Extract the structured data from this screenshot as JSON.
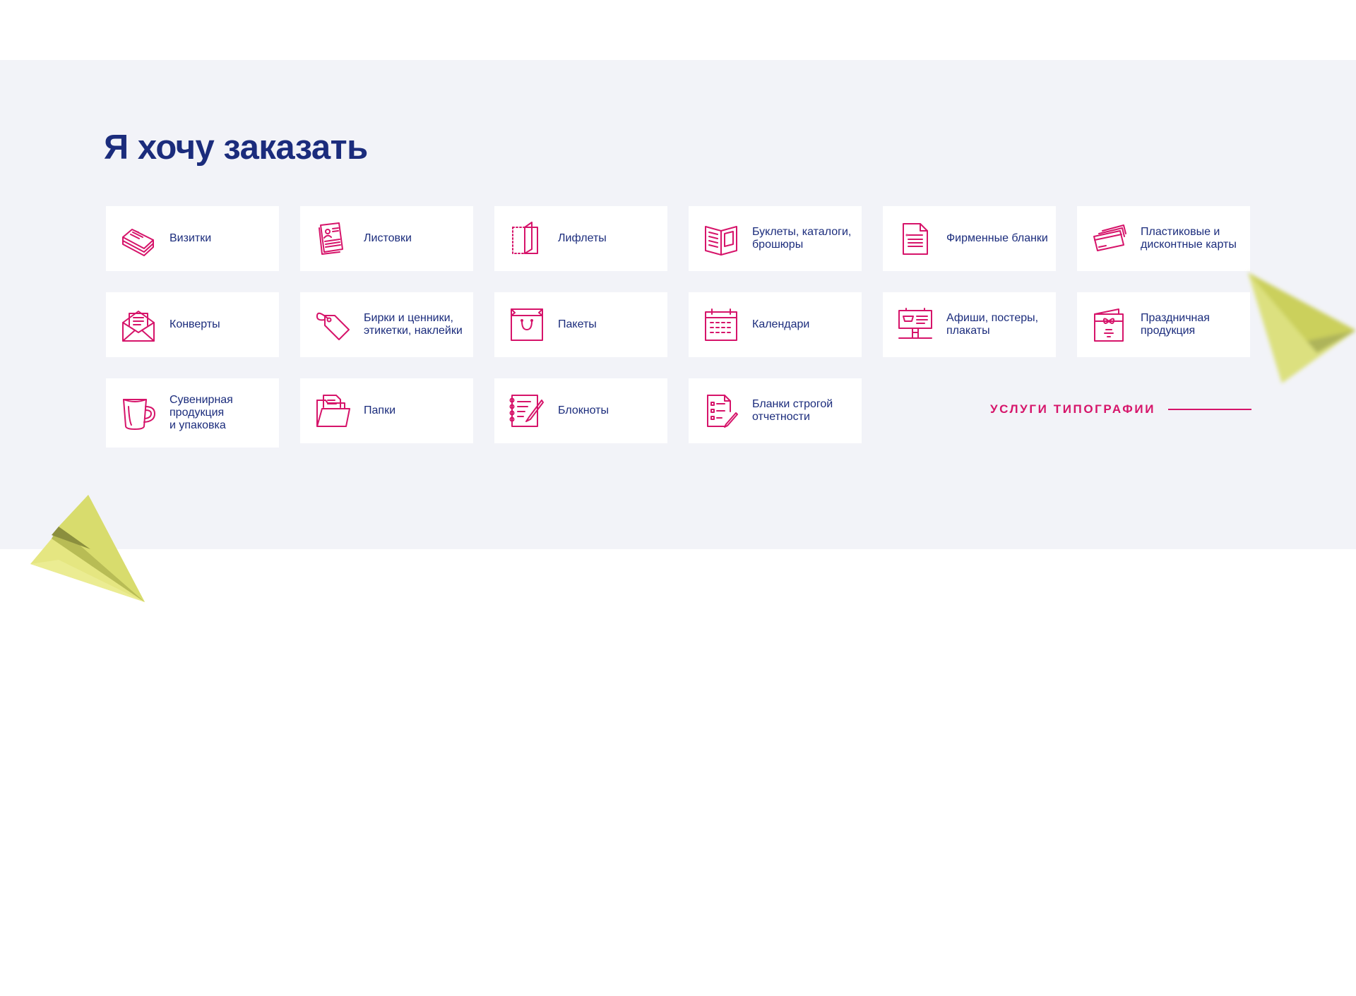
{
  "page": {
    "title": "Я хочу заказать",
    "accent_color": "#d6146a",
    "text_color": "#1b2c7c",
    "band_color": "#f2f3f8"
  },
  "products": [
    {
      "label": "Визитки",
      "icon": "business-cards-icon"
    },
    {
      "label": "Листовки",
      "icon": "flyers-icon"
    },
    {
      "label": "Лифлеты",
      "icon": "leaflet-icon"
    },
    {
      "label": "Буклеты, каталоги,\nброшюры",
      "icon": "booklet-icon"
    },
    {
      "label": "Фирменные бланки",
      "icon": "letterhead-icon"
    },
    {
      "label": "Пластиковые и\nдисконтные карты",
      "icon": "plastic-cards-icon"
    },
    {
      "label": "Конверты",
      "icon": "envelope-icon"
    },
    {
      "label": "Бирки и ценники,\nэтикетки, наклейки",
      "icon": "tag-icon"
    },
    {
      "label": "Пакеты",
      "icon": "bag-icon"
    },
    {
      "label": "Календари",
      "icon": "calendar-icon"
    },
    {
      "label": "Афиши, постеры,\nплакаты",
      "icon": "billboard-icon"
    },
    {
      "label": "Праздничная\nпродукция",
      "icon": "gift-card-icon"
    },
    {
      "label": "Сувенирная\nпродукция\nи упаковка",
      "icon": "mug-icon"
    },
    {
      "label": "Папки",
      "icon": "folder-icon"
    },
    {
      "label": "Блокноты",
      "icon": "notepad-icon"
    },
    {
      "label": "Бланки строгой\nотчетности",
      "icon": "checklist-form-icon"
    }
  ],
  "services_link": {
    "label": "УСЛУГИ ТИПОГРАФИИ"
  }
}
